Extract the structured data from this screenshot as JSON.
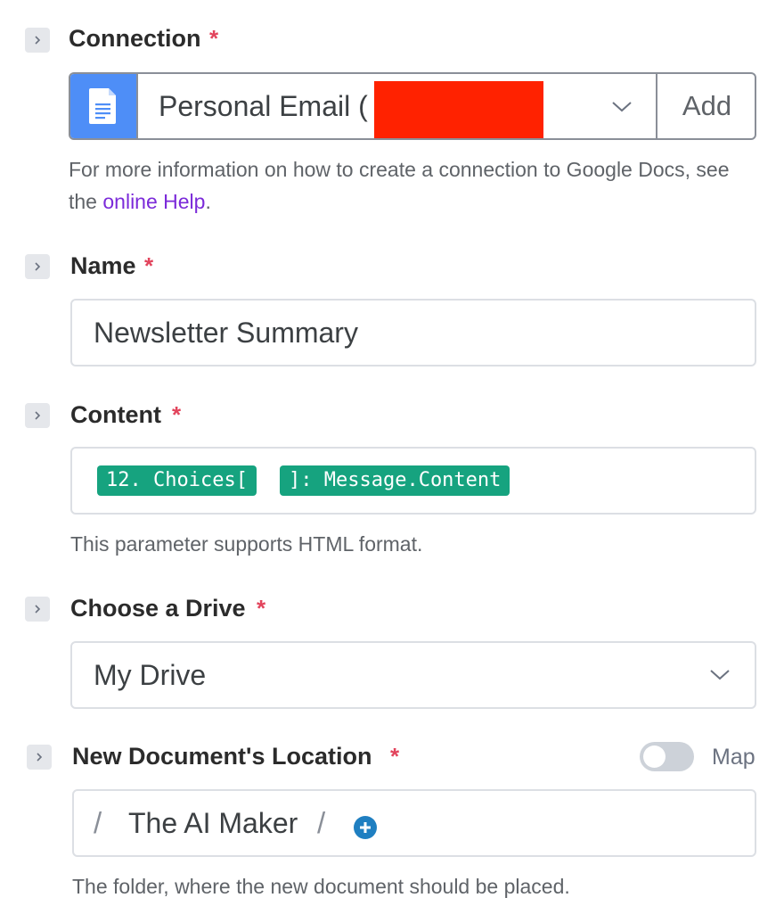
{
  "connection": {
    "label": "Connection",
    "required_mark": "*",
    "selected_value": "Personal Email (",
    "add_label": "Add",
    "help_prefix": "For more information on how to create a connection to Google Docs, see the ",
    "help_link": "online Help",
    "help_suffix": ".",
    "icon": "google-docs-icon",
    "accent_color": "#4e8ef7",
    "redaction_color": "#ff2200"
  },
  "name": {
    "label": "Name",
    "required_mark": "*",
    "value": "Newsletter Summary"
  },
  "content": {
    "label": "Content",
    "required_mark": "*",
    "chips": [
      "12. Choices[",
      "]: Message.Content"
    ],
    "chip_color": "#16a37f",
    "help": "This parameter supports HTML format."
  },
  "drive": {
    "label": "Choose a Drive",
    "required_mark": "*",
    "selected_value": "My Drive"
  },
  "location": {
    "label": "New Document's Location",
    "required_mark": "*",
    "map_label": "Map",
    "map_toggle_on": false,
    "path_separator": "/",
    "folder": "The AI Maker",
    "add_icon": "plus-circle-icon",
    "help": "The folder, where the new document should be placed."
  }
}
